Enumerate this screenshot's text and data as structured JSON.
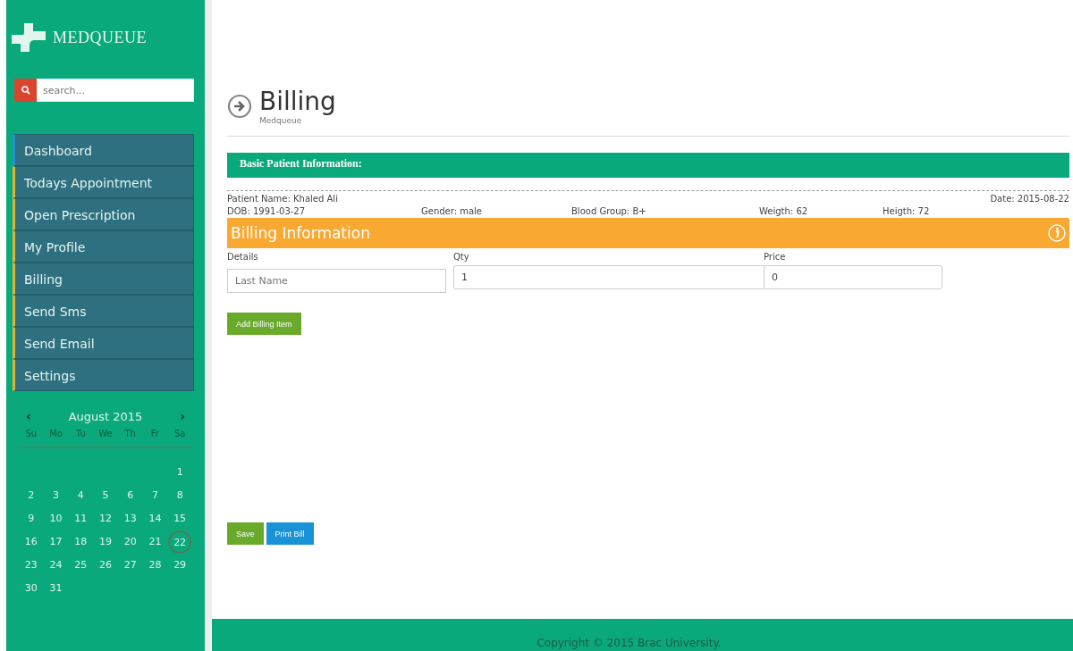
{
  "brand": {
    "name": "MEDQUEUE"
  },
  "search": {
    "placeholder": "search..."
  },
  "nav": [
    {
      "label": "Dashboard",
      "selected": true
    },
    {
      "label": "Todays Appointment",
      "selected": false
    },
    {
      "label": "Open Prescription",
      "selected": false
    },
    {
      "label": "My Profile",
      "selected": false
    },
    {
      "label": "Billing",
      "selected": false
    },
    {
      "label": "Send Sms",
      "selected": false
    },
    {
      "label": "Send Email",
      "selected": false
    },
    {
      "label": "Settings",
      "selected": false
    }
  ],
  "calendar": {
    "prev": "‹",
    "month": "August 2015",
    "next": "›",
    "weekdays": [
      "Su",
      "Mo",
      "Tu",
      "We",
      "Th",
      "Fr",
      "Sa"
    ],
    "weeks": [
      {
        "kind": "end",
        "days": [
          {
            "day": "1",
            "today": false
          }
        ]
      },
      {
        "kind": "start",
        "days": [
          {
            "day": "2",
            "today": false
          },
          {
            "day": "3",
            "today": false
          },
          {
            "day": "4",
            "today": false
          },
          {
            "day": "5",
            "today": false
          },
          {
            "day": "6",
            "today": false
          },
          {
            "day": "7",
            "today": false
          },
          {
            "day": "8",
            "today": false
          }
        ]
      },
      {
        "kind": "start",
        "days": [
          {
            "day": "9",
            "today": false
          },
          {
            "day": "10",
            "today": false
          },
          {
            "day": "11",
            "today": false
          },
          {
            "day": "12",
            "today": false
          },
          {
            "day": "13",
            "today": false
          },
          {
            "day": "14",
            "today": false
          },
          {
            "day": "15",
            "today": false
          }
        ]
      },
      {
        "kind": "start",
        "days": [
          {
            "day": "16",
            "today": false
          },
          {
            "day": "17",
            "today": false
          },
          {
            "day": "18",
            "today": false
          },
          {
            "day": "19",
            "today": false
          },
          {
            "day": "20",
            "today": false
          },
          {
            "day": "21",
            "today": false
          },
          {
            "day": "22",
            "today": true
          }
        ]
      },
      {
        "kind": "start",
        "days": [
          {
            "day": "23",
            "today": false
          },
          {
            "day": "24",
            "today": false
          },
          {
            "day": "25",
            "today": false
          },
          {
            "day": "26",
            "today": false
          },
          {
            "day": "27",
            "today": false
          },
          {
            "day": "28",
            "today": false
          },
          {
            "day": "29",
            "today": false
          }
        ]
      },
      {
        "kind": "start",
        "days": [
          {
            "day": "30",
            "today": false
          },
          {
            "day": "31",
            "today": false
          }
        ]
      }
    ]
  },
  "header": {
    "title": "Billing",
    "subtitle": "Medqueue"
  },
  "patient_section": {
    "title": "Basic Patient Information:",
    "name": "Patient Name: Khaled Ali",
    "date": "Date: 2015-08-22",
    "details": [
      "DOB: 1991-03-27",
      "Gender: male",
      "Blood Group: B+",
      "Weigth: 62",
      "Heigth: 72"
    ]
  },
  "billing": {
    "title": "Billing Information",
    "fields": [
      {
        "label": "Details",
        "placeholder": "Last Name"
      },
      {
        "label": "Qty",
        "value": "1"
      },
      {
        "label": "Price",
        "value": "0"
      }
    ],
    "add_button": "Add Billing Item"
  },
  "actions": [
    {
      "label": "Save",
      "kind": "save"
    },
    {
      "label": "Print Bill",
      "kind": "print"
    }
  ],
  "footer": "Copyright © 2015 Brac University."
}
